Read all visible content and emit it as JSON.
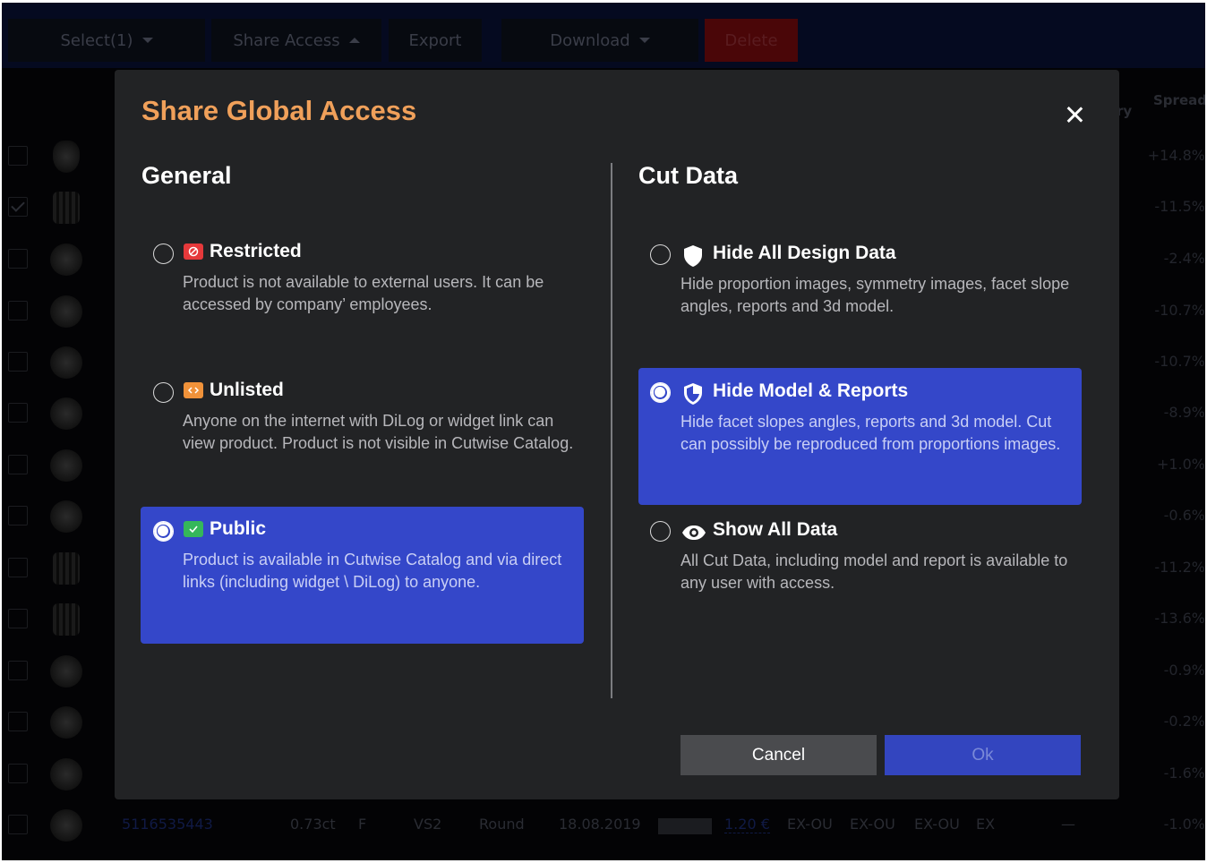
{
  "toolbar": {
    "select_label": "Select(1)",
    "share_label": "Share Access",
    "export_label": "Export",
    "download_label": "Download",
    "delete_label": "Delete"
  },
  "background_table": {
    "partial_header": "ry",
    "spread_header": "Spread",
    "spread_values": [
      "+14.8%",
      "-11.5%",
      "-2.4%",
      "-10.7%",
      "-10.7%",
      "-8.9%",
      "+1.0%",
      "-0.6%",
      "-11.2%",
      "-13.6%",
      "-0.9%",
      "-0.2%",
      "-1.6%",
      "-1.0%"
    ],
    "bottom_row": {
      "id": "5116535443",
      "carat": "0.73ct",
      "color": "F",
      "clarity": "VS2",
      "shape": "Round",
      "date": "18.08.2019",
      "price": "1.20 €",
      "cut": "EX-OU",
      "polish": "EX-OU",
      "symmetry": "EX-OU",
      "grade": "EX",
      "dash": "—"
    }
  },
  "modal": {
    "title": "Share Global Access",
    "general": {
      "heading": "General",
      "options": [
        {
          "title": "Restricted",
          "desc": "Product is not available to external users. It can be accessed by company’ employees.",
          "badge_color": "#e5393b",
          "selected": false
        },
        {
          "title": "Unlisted",
          "desc": "Anyone on the internet with DiLog or widget link can view product. Product is not visible in Cutwise Catalog.",
          "badge_color": "#f0923a",
          "selected": false
        },
        {
          "title": "Public",
          "desc": "Product is available in Cutwise Catalog and via direct links (including widget \\ DiLog) to anyone.",
          "badge_color": "#35b75a",
          "selected": true
        }
      ]
    },
    "cut_data": {
      "heading": "Cut Data",
      "options": [
        {
          "title": "Hide All Design Data",
          "desc": "Hide proportion images, symmetry images, facet slope angles, reports and 3d model.",
          "icon": "shield-icon",
          "selected": false
        },
        {
          "title": "Hide Model & Reports",
          "desc": "Hide facet slopes angles, reports and 3d model. Cut can possibly be reproduced from proportions images.",
          "icon": "shield-half-icon",
          "selected": true
        },
        {
          "title": "Show All Data",
          "desc": "All Cut Data, including model and report is available to any user with access.",
          "icon": "eye-icon",
          "selected": false
        }
      ]
    },
    "cancel_label": "Cancel",
    "ok_label": "Ok"
  }
}
